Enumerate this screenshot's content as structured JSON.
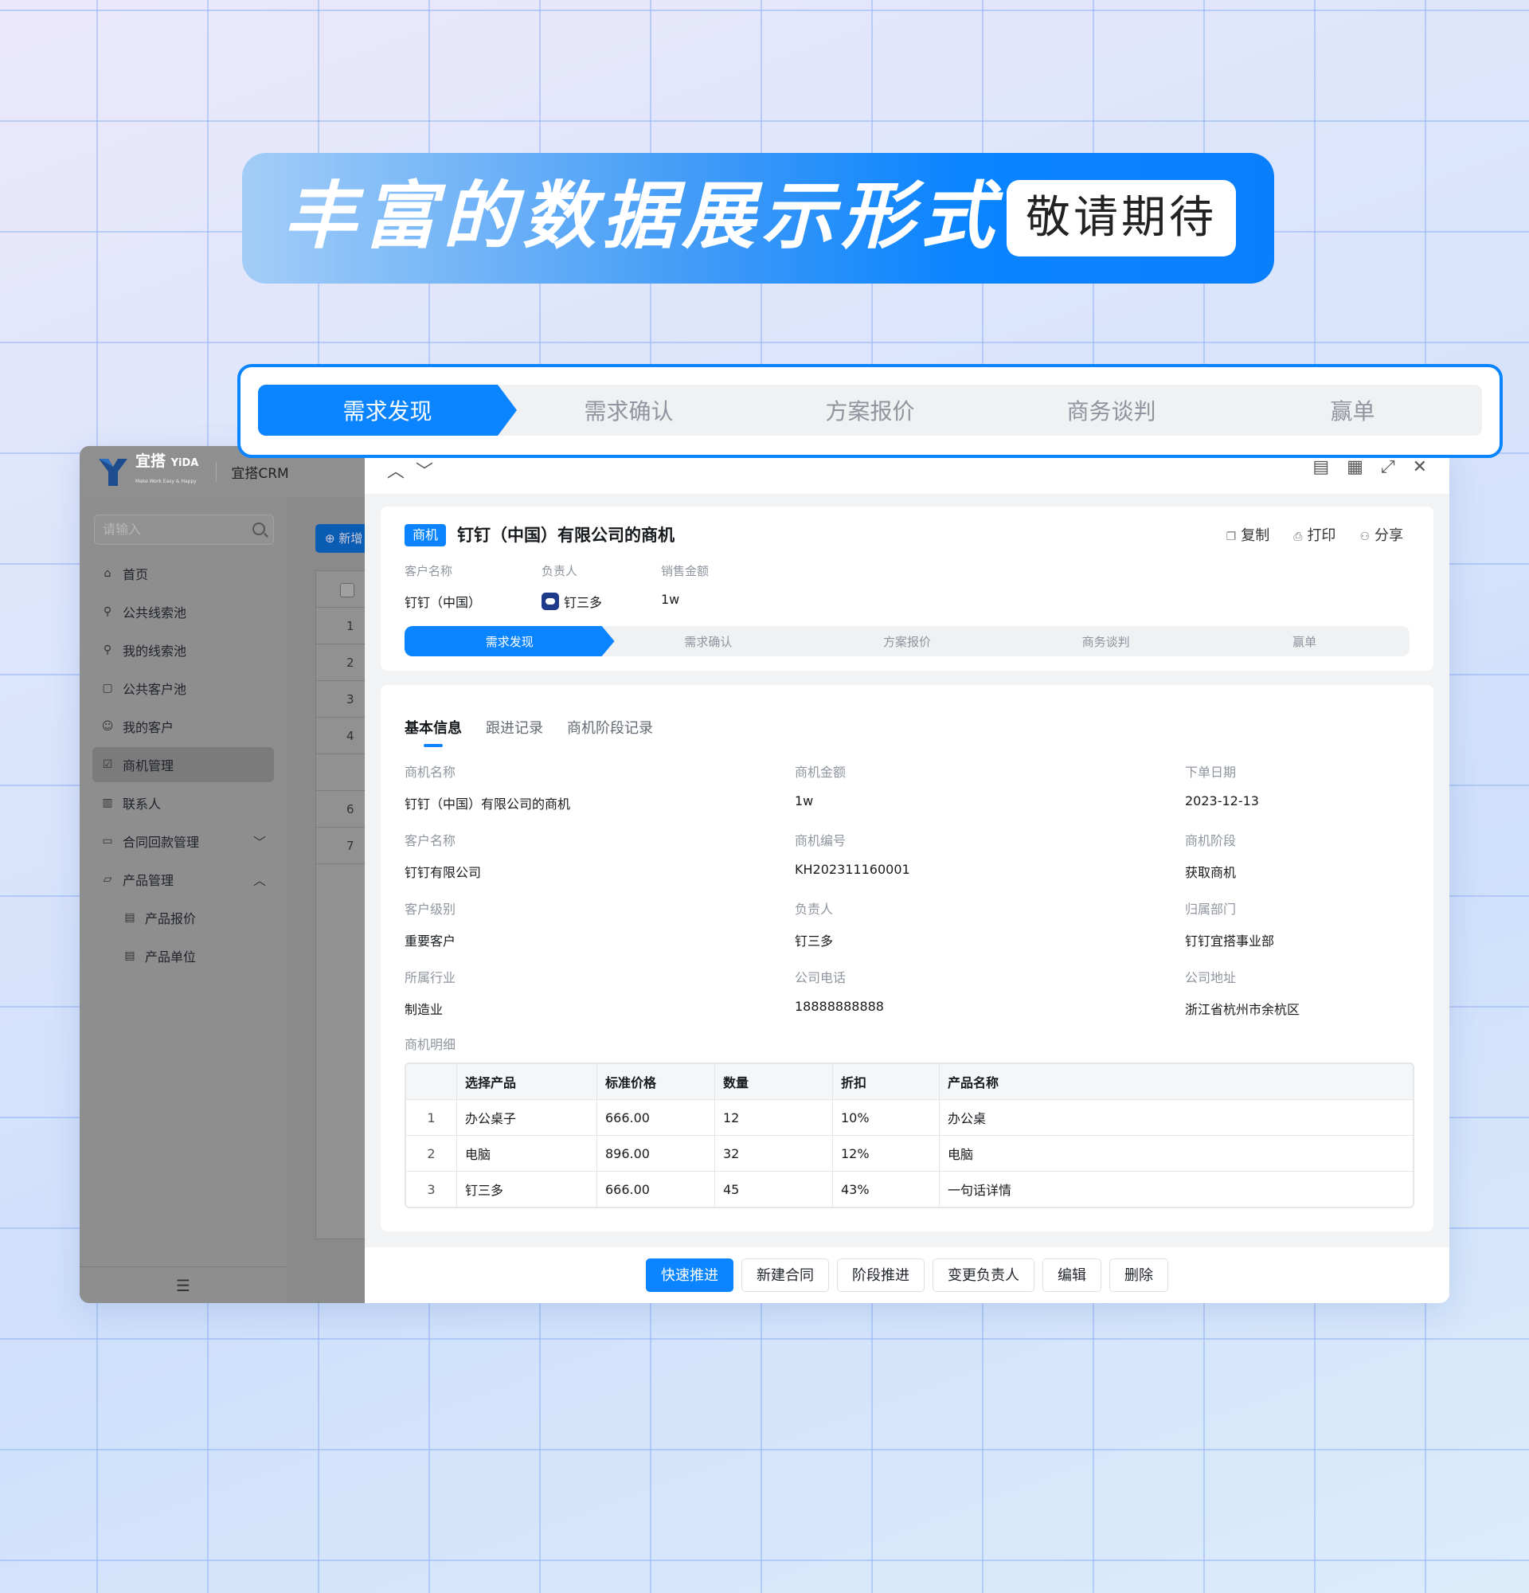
{
  "banner": {
    "title": "丰富的数据展示形式",
    "badge": "敬请期待"
  },
  "stages": [
    "需求发现",
    "需求确认",
    "方案报价",
    "商务谈判",
    "赢单"
  ],
  "app": {
    "logo": {
      "name": "宜搭",
      "brand": "YiDA",
      "slogan": "Make Work Easy & Happy"
    },
    "title": "宜搭CRM",
    "search_placeholder": "请输入",
    "menu": [
      {
        "label": "首页",
        "icon": "home-icon"
      },
      {
        "label": "公共线索池",
        "icon": "org-icon"
      },
      {
        "label": "我的线索池",
        "icon": "org-icon"
      },
      {
        "label": "公共客户池",
        "icon": "calendar-icon"
      },
      {
        "label": "我的客户",
        "icon": "user-icon"
      },
      {
        "label": "商机管理",
        "icon": "checklist-icon",
        "active": true
      },
      {
        "label": "联系人",
        "icon": "chart-icon"
      },
      {
        "label": "合同回款管理",
        "icon": "folder-icon",
        "chevron": "down"
      },
      {
        "label": "产品管理",
        "icon": "folder-open-icon",
        "chevron": "up"
      },
      {
        "label": "产品报价",
        "icon": "doc-icon",
        "sub": true
      },
      {
        "label": "产品单位",
        "icon": "doc-icon",
        "sub": true
      }
    ],
    "new_button": "新增",
    "list_rows": [
      "1",
      "2",
      "3",
      "4",
      "",
      "6",
      "7"
    ]
  },
  "detail": {
    "tag": "商机",
    "title": "钉钉（中国）有限公司的商机",
    "actions": [
      "复制",
      "打印",
      "分享"
    ],
    "summary": [
      {
        "label": "客户名称",
        "value": "钉钉（中国）"
      },
      {
        "label": "负责人",
        "value": "钉三多"
      },
      {
        "label": "销售金额",
        "value": "1w"
      }
    ],
    "tabs": [
      "基本信息",
      "跟进记录",
      "商机阶段记录"
    ],
    "fields": [
      {
        "label": "商机名称",
        "value": "钉钉（中国）有限公司的商机"
      },
      {
        "label": "商机金额",
        "value": "1w"
      },
      {
        "label": "下单日期",
        "value": "2023-12-13"
      },
      {
        "label": "客户名称",
        "value": "钉钉有限公司"
      },
      {
        "label": "商机编号",
        "value": "KH202311160001"
      },
      {
        "label": "商机阶段",
        "value": "获取商机"
      },
      {
        "label": "客户级别",
        "value": "重要客户"
      },
      {
        "label": "负责人",
        "value": "钉三多"
      },
      {
        "label": "归属部门",
        "value": "钉钉宜搭事业部"
      },
      {
        "label": "所属行业",
        "value": "制造业"
      },
      {
        "label": "公司电话",
        "value": "18888888888"
      },
      {
        "label": "公司地址",
        "value": "浙江省杭州市余杭区"
      }
    ],
    "table_label": "商机明细",
    "table_headers": [
      "",
      "选择产品",
      "标准价格",
      "数量",
      "折扣",
      "产品名称"
    ],
    "table_rows": [
      [
        "1",
        "办公桌子",
        "666.00",
        "12",
        "10%",
        "办公桌"
      ],
      [
        "2",
        "电脑",
        "896.00",
        "32",
        "12%",
        "电脑"
      ],
      [
        "3",
        "钉三多",
        "666.00",
        "45",
        "43%",
        "一句话详情"
      ]
    ],
    "footer_buttons": [
      "快速推进",
      "新建合同",
      "阶段推进",
      "变更负责人",
      "编辑",
      "删除"
    ]
  },
  "colors": {
    "primary": "#0a84ff",
    "banner_end": "#0a7ffb",
    "sidebar_dim": "#8f8f90"
  }
}
